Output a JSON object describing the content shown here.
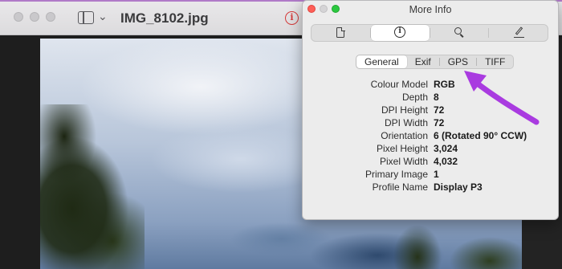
{
  "window": {
    "title": "IMG_8102.jpg",
    "toolbar_chevron": "⌄",
    "info_icon_glyph": "i"
  },
  "panel": {
    "title": "More Info",
    "icon_tabs": [
      "document-icon",
      "info-icon",
      "search-icon",
      "pencil-icon"
    ],
    "info_glyph": "i",
    "text_tabs": [
      "General",
      "Exif",
      "GPS",
      "TIFF"
    ],
    "active_text_tab": "General",
    "rows": [
      {
        "label": "Colour Model",
        "value": "RGB"
      },
      {
        "label": "Depth",
        "value": "8"
      },
      {
        "label": "DPI Height",
        "value": "72"
      },
      {
        "label": "DPI Width",
        "value": "72"
      },
      {
        "label": "Orientation",
        "value": "6 (Rotated 90° CCW)"
      },
      {
        "label": "Pixel Height",
        "value": "3,024"
      },
      {
        "label": "Pixel Width",
        "value": "4,032"
      },
      {
        "label": "Primary Image",
        "value": "1"
      },
      {
        "label": "Profile Name",
        "value": "Display P3"
      }
    ]
  },
  "colors": {
    "annotation_arrow": "#a93be0",
    "close_button": "#fe5f57",
    "zoom_button": "#2bc840",
    "info_badge": "#d53a3a"
  }
}
